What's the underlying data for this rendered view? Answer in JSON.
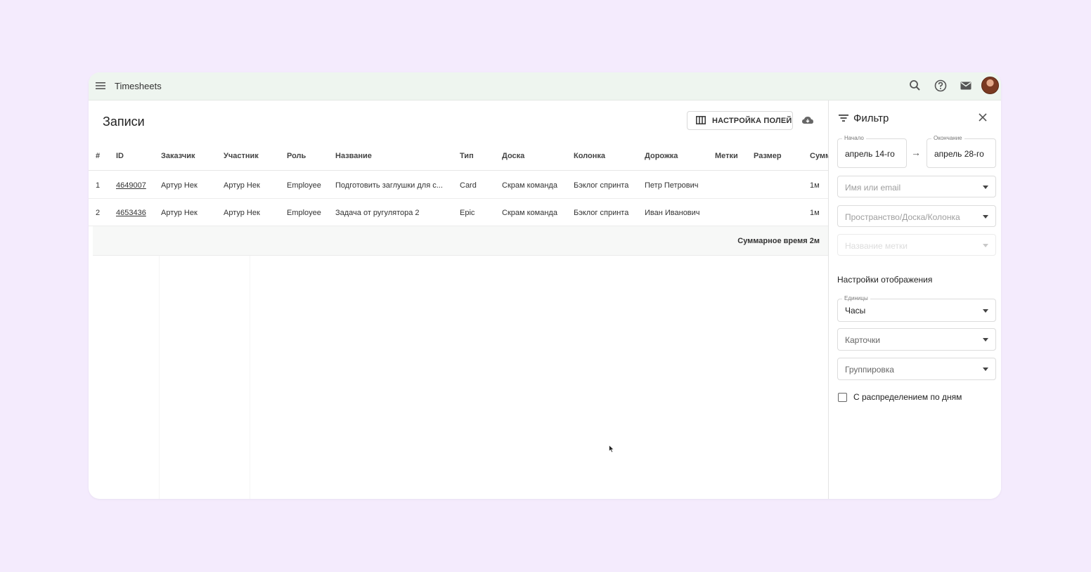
{
  "app": {
    "title": "Timesheets"
  },
  "icons": {
    "menu": "menu-icon",
    "search": "search-icon",
    "help": "help-icon",
    "mail": "mail-icon",
    "avatar": "avatar",
    "columns": "columns-icon",
    "download": "cloud-download-icon",
    "filter": "filter-icon",
    "close": "close-icon"
  },
  "main": {
    "title": "Записи",
    "fields_button": "НАСТРОЙКА ПОЛЕЙ",
    "columns": [
      "#",
      "ID",
      "Заказчик",
      "Участник",
      "Роль",
      "Название",
      "Тип",
      "Доска",
      "Колонка",
      "Дорожка",
      "Метки",
      "Размер",
      "Сумм"
    ],
    "rows": [
      {
        "num": "1",
        "id": "4649007",
        "customer": "Артур Нек",
        "participant": "Артур Нек",
        "role": "Employee",
        "name": "Подготовить заглушки для с...",
        "type": "Card",
        "board": "Скрам команда",
        "column": "Бэклог спринта",
        "lane": "Петр Петрович",
        "tags": "",
        "size": "",
        "sum": "1м"
      },
      {
        "num": "2",
        "id": "4653436",
        "customer": "Артур Нек",
        "participant": "Артур Нек",
        "role": "Employee",
        "name": "Задача от ругулятора 2",
        "type": "Epic",
        "board": "Скрам команда",
        "column": "Бэклог спринта",
        "lane": "Иван Иванович",
        "tags": "",
        "size": "",
        "sum": "1м"
      }
    ],
    "summary": "Суммарное время 2м"
  },
  "filter": {
    "title": "Фильтр",
    "start_label": "Начало",
    "start_value": "апрель 14-го",
    "end_label": "Окончание",
    "end_value": "апрель 28-го",
    "arrow": "→",
    "name_placeholder": "Имя или email",
    "space_placeholder": "Пространство/Доска/Колонка",
    "tag_placeholder": "Название метки",
    "display_title": "Настройки отображения",
    "units_label": "Единицы",
    "units_value": "Часы",
    "cards_placeholder": "Карточки",
    "grouping_placeholder": "Группировка",
    "by_days_label": "С распределением по дням"
  }
}
